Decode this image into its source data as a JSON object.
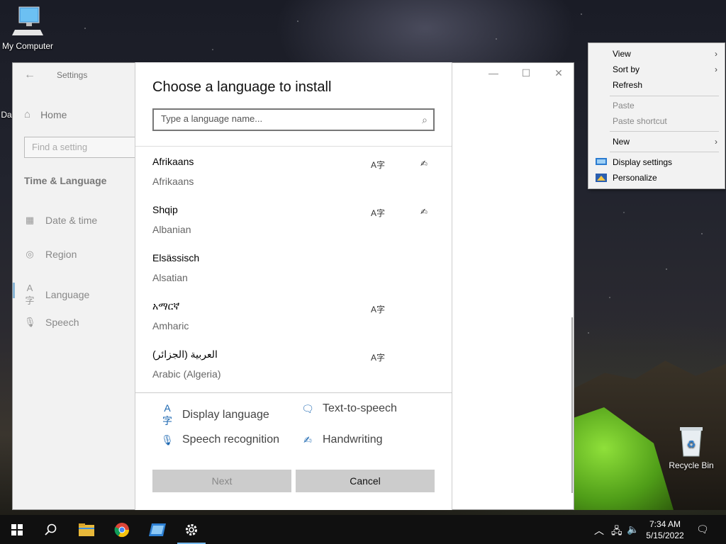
{
  "desktop": {
    "icons": {
      "my_computer": "My Computer",
      "recycle_bin": "Recycle Bin",
      "partial": "Da"
    }
  },
  "settings": {
    "title": "Settings",
    "home": "Home",
    "search_placeholder": "Find a setting",
    "section": "Time & Language",
    "nav": [
      {
        "label": "Date & time",
        "icon": "calendar-clock-icon"
      },
      {
        "label": "Region",
        "icon": "globe-icon"
      },
      {
        "label": "Language",
        "icon": "language-icon"
      },
      {
        "label": "Speech",
        "icon": "microphone-icon"
      }
    ],
    "active_nav": "Language"
  },
  "dialog": {
    "title": "Choose a language to install",
    "search_placeholder": "Type a language name...",
    "languages": [
      {
        "native": "Afrikaans",
        "english": "Afrikaans",
        "display": true,
        "handwriting": true
      },
      {
        "native": "Shqip",
        "english": "Albanian",
        "display": true,
        "handwriting": true
      },
      {
        "native": "Elsässisch",
        "english": "Alsatian",
        "display": false,
        "handwriting": false
      },
      {
        "native": "አማርኛ",
        "english": "Amharic",
        "display": true,
        "handwriting": false
      },
      {
        "native": "العربية (الجزائر)",
        "english": "Arabic (Algeria)",
        "display": true,
        "handwriting": false
      }
    ],
    "legend": {
      "display_language": "Display language",
      "text_to_speech": "Text-to-speech",
      "speech_recognition": "Speech recognition",
      "handwriting": "Handwriting"
    },
    "buttons": {
      "next": "Next",
      "cancel": "Cancel"
    }
  },
  "context_menu": {
    "items": [
      {
        "label": "View",
        "submenu": true,
        "disabled": false
      },
      {
        "label": "Sort by",
        "submenu": true,
        "disabled": false
      },
      {
        "label": "Refresh",
        "submenu": false,
        "disabled": false
      },
      {
        "label": "Paste",
        "submenu": false,
        "disabled": true
      },
      {
        "label": "Paste shortcut",
        "submenu": false,
        "disabled": true
      },
      {
        "label": "New",
        "submenu": true,
        "disabled": false
      },
      {
        "label": "Display settings",
        "submenu": false,
        "disabled": false,
        "icon": "display-settings-icon"
      },
      {
        "label": "Personalize",
        "submenu": false,
        "disabled": false,
        "icon": "personalize-icon"
      }
    ]
  },
  "taskbar": {
    "apps": [
      "start-icon",
      "search-icon",
      "file-explorer-icon",
      "chrome-icon",
      "app-window-icon",
      "settings-gear-icon"
    ],
    "active_app": "settings-gear-icon",
    "time": "7:34 AM",
    "date": "5/15/2022"
  },
  "colors": {
    "accent": "#1a66b0",
    "taskbar": "#101010",
    "active_indicator": "#76b9ed"
  }
}
